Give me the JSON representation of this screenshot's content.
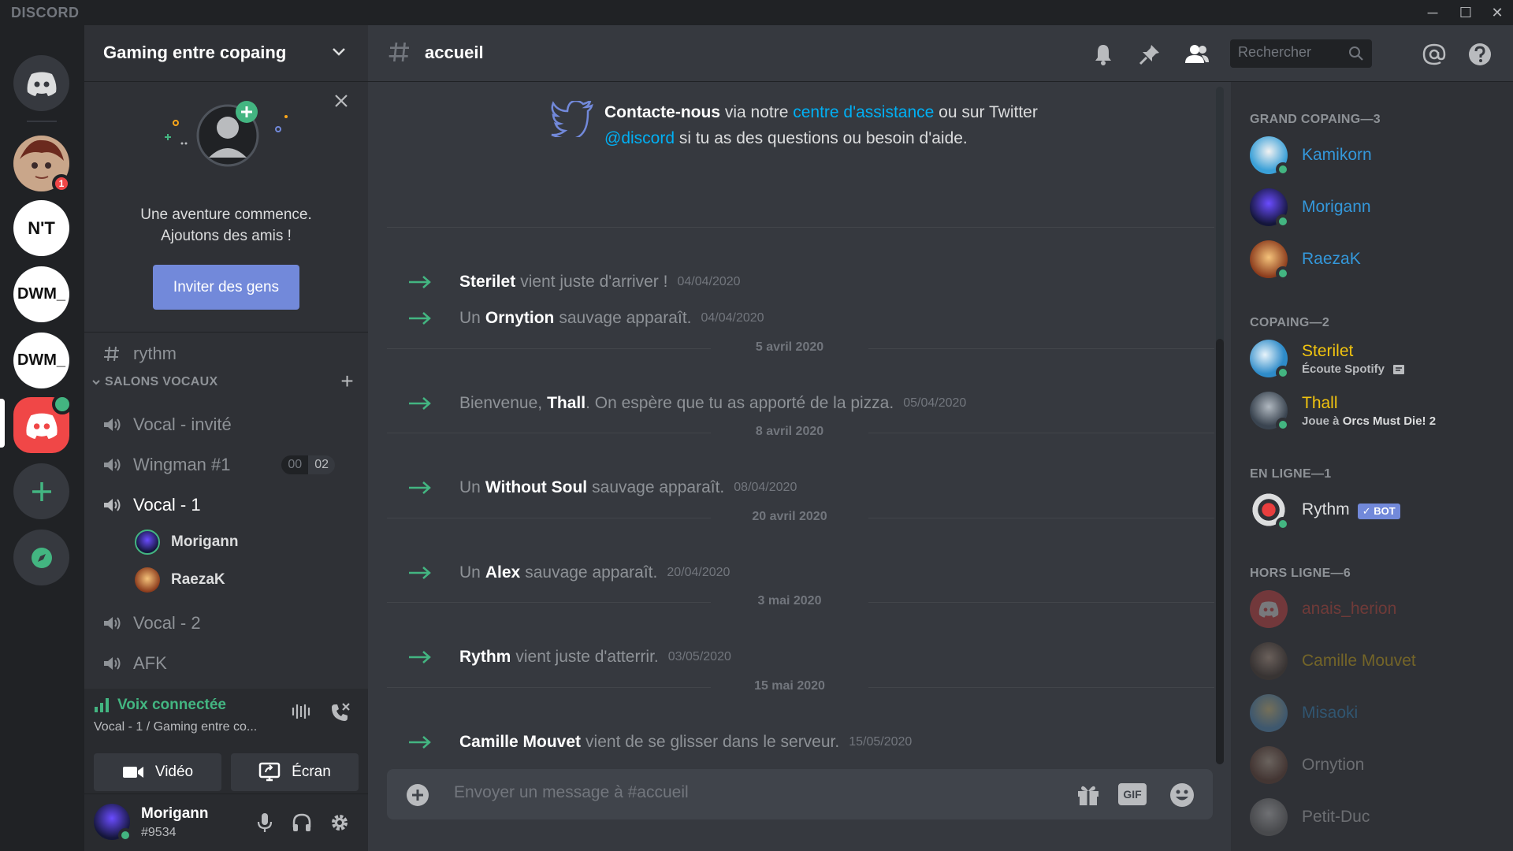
{
  "window": {
    "brand": "DISCORD",
    "controls": [
      "─",
      "☐",
      "✕"
    ]
  },
  "rail": {
    "servers": [
      {
        "name": "home",
        "icon": "discord-logo-icon"
      },
      {
        "name": "avatar-server",
        "badge": "1"
      },
      {
        "name": "nt-server",
        "label": "N'T"
      },
      {
        "name": "dwm-server-1",
        "label": "DWM_"
      },
      {
        "name": "dwm-server-2",
        "label": "DWM_"
      },
      {
        "name": "gaming-server",
        "icon": "discord-logo-icon"
      },
      {
        "name": "add-server",
        "icon": "plus-icon"
      },
      {
        "name": "explore",
        "icon": "compass-icon"
      }
    ]
  },
  "sidebar": {
    "server_name": "Gaming entre copaing",
    "invite": {
      "line1": "Une aventure commence.",
      "line2": "Ajoutons des amis !",
      "button": "Inviter des gens"
    },
    "text_channels": [
      {
        "name": "rythm"
      }
    ],
    "voice_category": "SALONS VOCAUX",
    "voice_channels": [
      {
        "name": "Vocal - invité"
      },
      {
        "name": "Wingman #1",
        "counter": [
          "00",
          "02"
        ]
      },
      {
        "name": "Vocal - 1",
        "users": [
          "Morigann",
          "RaezaK"
        ]
      },
      {
        "name": "Vocal - 2"
      },
      {
        "name": "AFK"
      }
    ],
    "voice_panel": {
      "status": "Voix connectée",
      "sub": "Vocal - 1 / Gaming entre co...",
      "video": "Vidéo",
      "screen": "Écran"
    },
    "user": {
      "name": "Morigann",
      "tag": "#9534"
    }
  },
  "chat": {
    "channel": "accueil",
    "search_placeholder": "Rechercher",
    "welcome": {
      "bold": "Contacte-nous",
      "t1": " via notre ",
      "link1": "centre d'assistance",
      "t2": " ou sur Twitter ",
      "link2": "@discord",
      "t3": " si tu as des questions ou besoin d'aide."
    },
    "messages": [
      {
        "pre": "",
        "who": "Sterilet",
        "post": "vient juste d'arriver !",
        "ts": "04/04/2020"
      },
      {
        "pre": "Un",
        "who": "Ornytion",
        "post": "sauvage apparaît.",
        "ts": "04/04/2020"
      },
      {
        "divider": "5 avril 2020"
      },
      {
        "pre": "Bienvenue,",
        "who": "Thall",
        "post": ". On espère que tu as apporté de la pizza.",
        "ts": "05/04/2020"
      },
      {
        "divider": "8 avril 2020"
      },
      {
        "pre": "Un",
        "who": "Without Soul",
        "post": "sauvage apparaît.",
        "ts": "08/04/2020"
      },
      {
        "divider": "20 avril 2020"
      },
      {
        "pre": "Un",
        "who": "Alex",
        "post": "sauvage apparaît.",
        "ts": "20/04/2020"
      },
      {
        "divider": "3 mai 2020"
      },
      {
        "pre": "",
        "who": "Rythm",
        "post": "vient juste d'atterrir.",
        "ts": "03/05/2020"
      },
      {
        "divider": "15 mai 2020"
      },
      {
        "pre": "",
        "who": "Camille Mouvet",
        "post": "vient de se glisser dans le serveur.",
        "ts": "15/05/2020"
      }
    ],
    "composer_placeholder": "Envoyer un message à #accueil",
    "composer_gif": "GIF"
  },
  "members": {
    "categories": [
      {
        "title": "GRAND COPAING—3",
        "color": "#3498db",
        "members": [
          {
            "name": "Kamikorn",
            "online": true
          },
          {
            "name": "Morigann",
            "online": true
          },
          {
            "name": "RaezaK",
            "online": true
          }
        ]
      },
      {
        "title": "COPAING—2",
        "color": "#f1c40f",
        "members": [
          {
            "name": "Sterilet",
            "activity": "Écoute Spotify",
            "online": true
          },
          {
            "name": "Thall",
            "activity_pre": "Joue à ",
            "activity_bold": "Orcs Must Die! 2",
            "online": true
          }
        ]
      },
      {
        "title": "EN LIGNE—1",
        "color": "#dcddde",
        "members": [
          {
            "name": "Rythm",
            "bot": "✓ BOT",
            "online": true
          }
        ]
      },
      {
        "title": "HORS LIGNE—6",
        "color": "#dcddde",
        "members": [
          {
            "name": "anais_herion",
            "color": "#e74c3c"
          },
          {
            "name": "Camille Mouvet",
            "color": "#f1c40f"
          },
          {
            "name": "Misaoki",
            "color": "#3498db"
          },
          {
            "name": "Ornytion",
            "color": "#dcddde"
          },
          {
            "name": "Petit-Duc",
            "color": "#dcddde"
          }
        ]
      }
    ]
  },
  "colors": {
    "blurple": "#7289da",
    "online": "#43b581",
    "link": "#00b0f4",
    "grand_copaing": "#3498db",
    "copaing": "#f1c40f"
  }
}
